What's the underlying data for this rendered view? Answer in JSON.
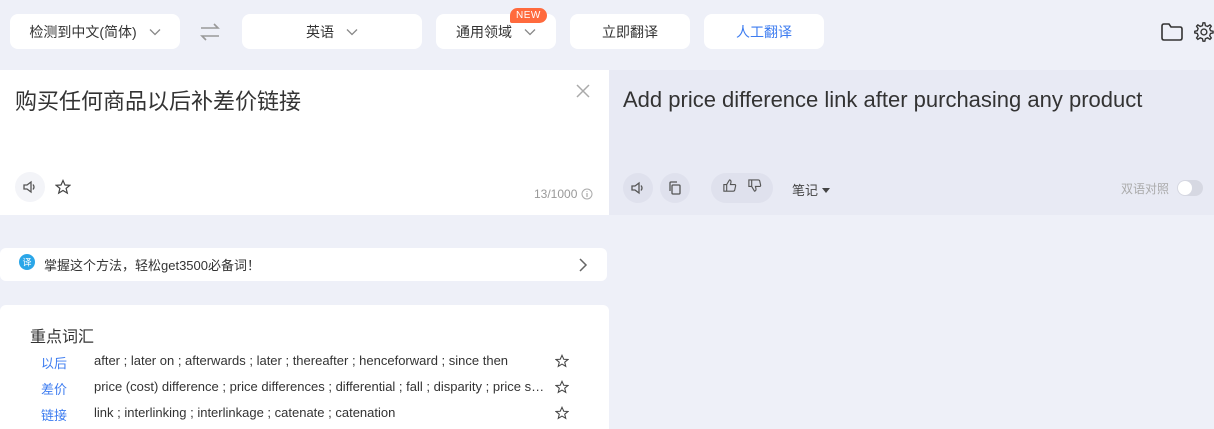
{
  "toolbar": {
    "source_lang": "检测到中文(简体)",
    "target_lang": "英语",
    "domain": "通用领域",
    "new_badge": "NEW",
    "translate_label": "立即翻译",
    "human_label": "人工翻译"
  },
  "source": {
    "text": "购买任何商品以后补差价链接",
    "char_count": "13/1000"
  },
  "target": {
    "text": "Add price difference link after purchasing any product",
    "notes_label": "笔记",
    "bilingual_label": "双语对照"
  },
  "tip": {
    "icon_char": "译",
    "text": "掌握这个方法，轻松get3500必备词！"
  },
  "vocab": {
    "title": "重点词汇",
    "rows": [
      {
        "word": "以后",
        "def": "after ; later on ; afterwards ; later ; thereafter ; henceforward ; since then"
      },
      {
        "word": "差价",
        "def": "price (cost) difference ; price differences ; differential ; fall ; disparity ; price spread"
      },
      {
        "word": "链接",
        "def": "link ; interlinking ; interlinkage ; catenate ; catenation"
      }
    ]
  },
  "colors": {
    "accent": "#3d7cf0",
    "badge": "#ff6a3d",
    "background": "#eef0f8"
  }
}
